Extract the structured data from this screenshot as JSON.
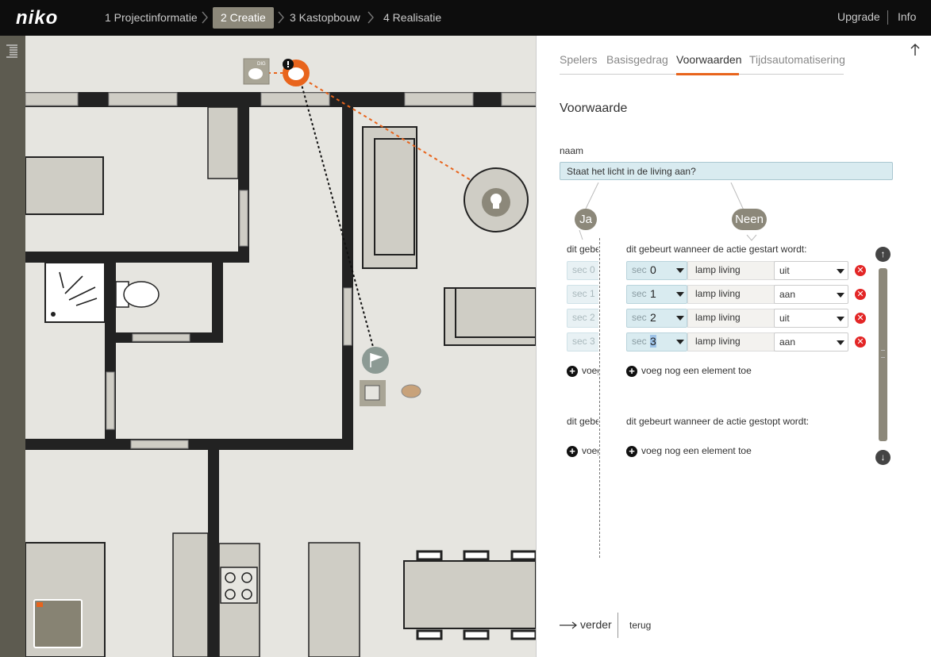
{
  "logo": "niko",
  "steps": [
    "1 Projectinformatie",
    "2 Creatie",
    "3 Kastopbouw",
    "4 Realisatie"
  ],
  "top_links": {
    "upgrade": "Upgrade",
    "info": "Info"
  },
  "map": {
    "device_label": "DIG"
  },
  "panel": {
    "tabs": [
      "Spelers",
      "Basisgedrag",
      "Voorwaarden",
      "Tijdsautomatisering"
    ],
    "active_tab": "Voorwaarden",
    "section_title": "Voorwaarde",
    "name_label": "naam",
    "name_value": "Staat het licht in de living aan?",
    "bubble_yes": "Ja",
    "bubble_no": "Neen",
    "yes_started_header": "dit gebeurt wanneer de actie gestart wordt:",
    "no_started_header": "dit gebeurt wanneer de actie gestart wordt:",
    "yes_stopped_header": "dit gebeurt wanneer de actie gestopt wordt:",
    "no_stopped_header": "dit gebeurt wanneer de actie gestopt wordt:",
    "sec_label": "sec",
    "yes_ghost_rows": [
      "sec 0",
      "sec 1",
      "sec 2",
      "sec 3"
    ],
    "rows": [
      {
        "sec": "0",
        "device": "lamp living",
        "state": "uit"
      },
      {
        "sec": "1",
        "device": "lamp living",
        "state": "aan"
      },
      {
        "sec": "2",
        "device": "lamp living",
        "state": "uit"
      },
      {
        "sec": "3",
        "device": "lamp living",
        "state": "aan"
      }
    ],
    "add_element": "voeg nog een element toe",
    "next": "verder",
    "back": "terug"
  },
  "colors": {
    "accent": "#e8641c",
    "warm_grey": "#8c887a",
    "input_bg": "#d9ebf0",
    "delete": "#e32626"
  }
}
